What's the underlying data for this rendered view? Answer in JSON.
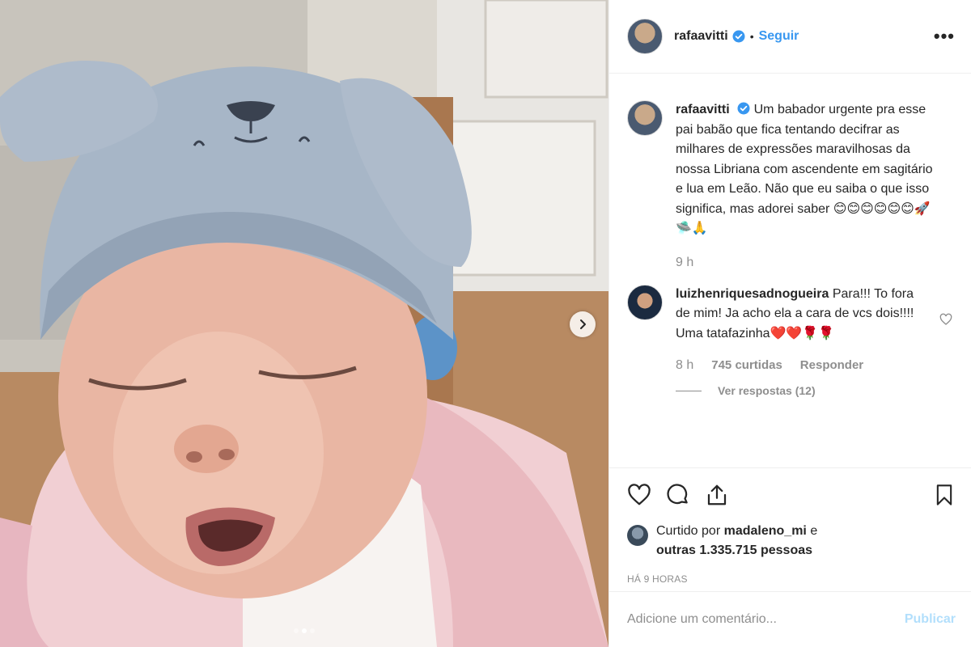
{
  "post": {
    "carousel": {
      "slide_count": 3,
      "active_index": 1
    }
  },
  "header": {
    "username": "rafaavitti",
    "separator": "•",
    "follow_label": "Seguir",
    "more_label": "•••"
  },
  "caption": {
    "username": "rafaavitti",
    "text": "Um babador urgente pra esse pai babão que fica tentando decifrar as milhares de expressões maravilhosas da nossa Libriana com ascendente em sagitário e lua em Leão. Não que eu saiba o que isso significa, mas adorei saber 😊😊😊😊😊😊🚀🛸🙏",
    "time": "9 h"
  },
  "comment": {
    "username": "luizhenriquesadnogueira",
    "text": "Para!!! To fora de mim! Ja acho ela a cara de vcs dois!!!! Uma tatafazinha❤️❤️🌹🌹",
    "time": "8 h",
    "likes": "745 curtidas",
    "reply_label": "Responder",
    "view_replies": "Ver respostas (12)"
  },
  "likes": {
    "prefix": "Curtido por",
    "user": "madaleno_mi",
    "joiner": "e",
    "others": "outras 1.335.715 pessoas"
  },
  "timestamp": "HÁ 9 HORAS",
  "add_comment": {
    "placeholder": "Adicione um comentário...",
    "publish_label": "Publicar"
  },
  "colors": {
    "link_blue": "#3897f0",
    "publish_disabled": "#b2dffc",
    "muted": "#8e8e8e",
    "verified": "#3897f0"
  }
}
